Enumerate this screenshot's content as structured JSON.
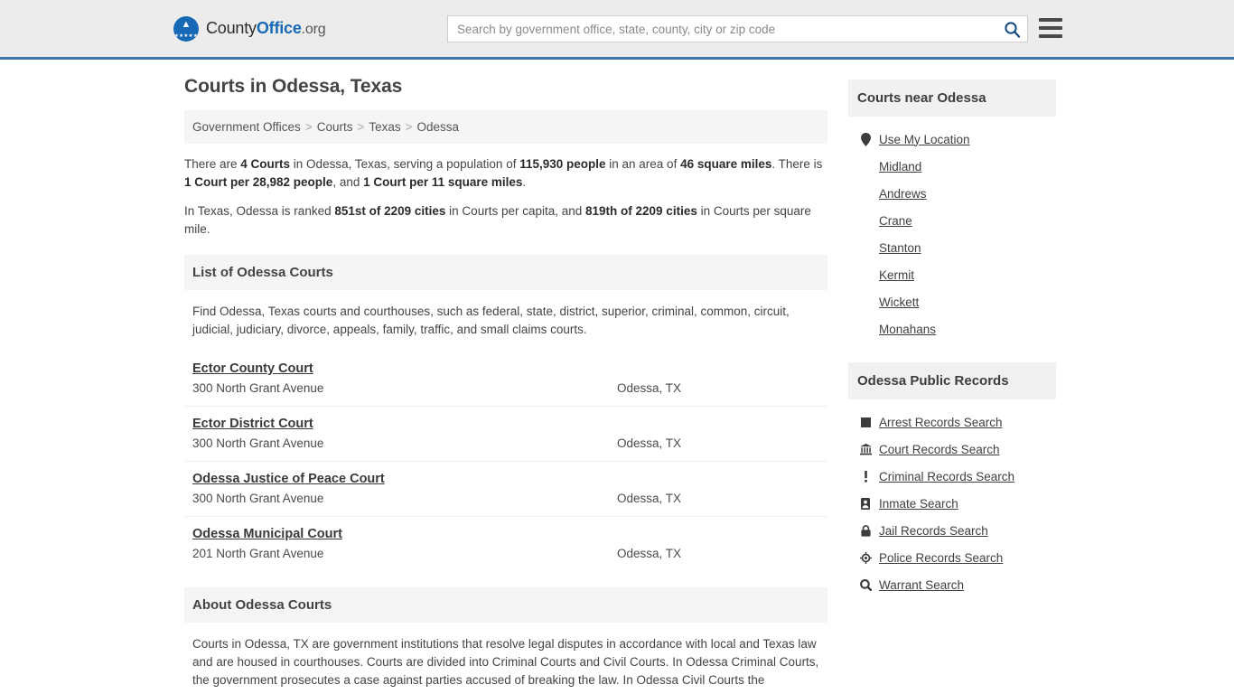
{
  "header": {
    "logo": {
      "part1": "County",
      "part2": "Office",
      "part3": ".org",
      "eagle_glyph": "ὔ",
      "stars_glyph": "★★★★★"
    },
    "search": {
      "placeholder": "Search by government office, state, county, city or zip code",
      "value": "",
      "search_icon": "search-icon"
    },
    "menu_icon": "hamburger-menu-icon",
    "accent_color": "#3e75a7",
    "logo_blue": "#1769b5",
    "background": "#ececec"
  },
  "main": {
    "page_title": "Courts in Odessa, Texas",
    "breadcrumb": [
      {
        "label": "Government Offices"
      },
      {
        "label": "Courts"
      },
      {
        "label": "Texas"
      },
      {
        "label": "Odessa"
      }
    ],
    "breadcrumb_separator": ">",
    "stats": {
      "p1_a": "There are ",
      "p1_b1": "4 Courts",
      "p1_c": " in Odessa, Texas, serving a population of ",
      "p1_b2": "115,930 people",
      "p1_d": " in an area of ",
      "p1_b3": "46 square miles",
      "p1_e": ". There is ",
      "p1_b4": "1 Court per 28,982 people",
      "p1_f": ", and ",
      "p1_b5": "1 Court per 11 square miles",
      "p1_g": ".",
      "p2_a": "In Texas, Odessa is ranked ",
      "p2_b1": "851st of 2209 cities",
      "p2_c": " in Courts per capita, and ",
      "p2_b2": "819th of 2209 cities",
      "p2_d": " in Courts per square mile."
    },
    "list_section": {
      "heading": "List of Odessa Courts",
      "description": "Find Odessa, Texas courts and courthouses, such as federal, state, district, superior, criminal, common, circuit, judicial, judiciary, divorce, appeals, family, traffic, and small claims courts."
    },
    "courts": [
      {
        "name": "Ector County Court",
        "address": "300 North Grant Avenue",
        "city": "Odessa, TX"
      },
      {
        "name": "Ector District Court",
        "address": "300 North Grant Avenue",
        "city": "Odessa, TX"
      },
      {
        "name": "Odessa Justice of Peace Court",
        "address": "300 North Grant Avenue",
        "city": "Odessa, TX"
      },
      {
        "name": "Odessa Municipal Court",
        "address": "201 North Grant Avenue",
        "city": "Odessa, TX"
      }
    ],
    "about_section": {
      "heading": "About Odessa Courts",
      "description": "Courts in Odessa, TX are government institutions that resolve legal disputes in accordance with local and Texas law and are housed in courthouses. Courts are divided into Criminal Courts and Civil Courts. In Odessa Criminal Courts, the government prosecutes a case against parties accused of breaking the law. In Odessa Civil Courts the"
    }
  },
  "sidebar": {
    "nearby": {
      "heading": "Courts near Odessa",
      "items": [
        {
          "label": "Use My Location",
          "icon": "map-pin-icon"
        },
        {
          "label": "Midland",
          "icon": ""
        },
        {
          "label": "Andrews",
          "icon": ""
        },
        {
          "label": "Crane",
          "icon": ""
        },
        {
          "label": "Stanton",
          "icon": ""
        },
        {
          "label": "Kermit",
          "icon": ""
        },
        {
          "label": "Wickett",
          "icon": ""
        },
        {
          "label": "Monahans",
          "icon": ""
        }
      ]
    },
    "public_records": {
      "heading": "Odessa Public Records",
      "items": [
        {
          "label": "Arrest Records Search",
          "icon": "square-icon"
        },
        {
          "label": "Court Records Search",
          "icon": "courthouse-icon"
        },
        {
          "label": "Criminal Records Search",
          "icon": "exclamation-icon"
        },
        {
          "label": "Inmate Search",
          "icon": "id-badge-icon"
        },
        {
          "label": "Jail Records Search",
          "icon": "padlock-icon"
        },
        {
          "label": "Police Records Search",
          "icon": "police-badge-icon"
        },
        {
          "label": "Warrant Search",
          "icon": "magnifier-icon"
        }
      ]
    }
  }
}
